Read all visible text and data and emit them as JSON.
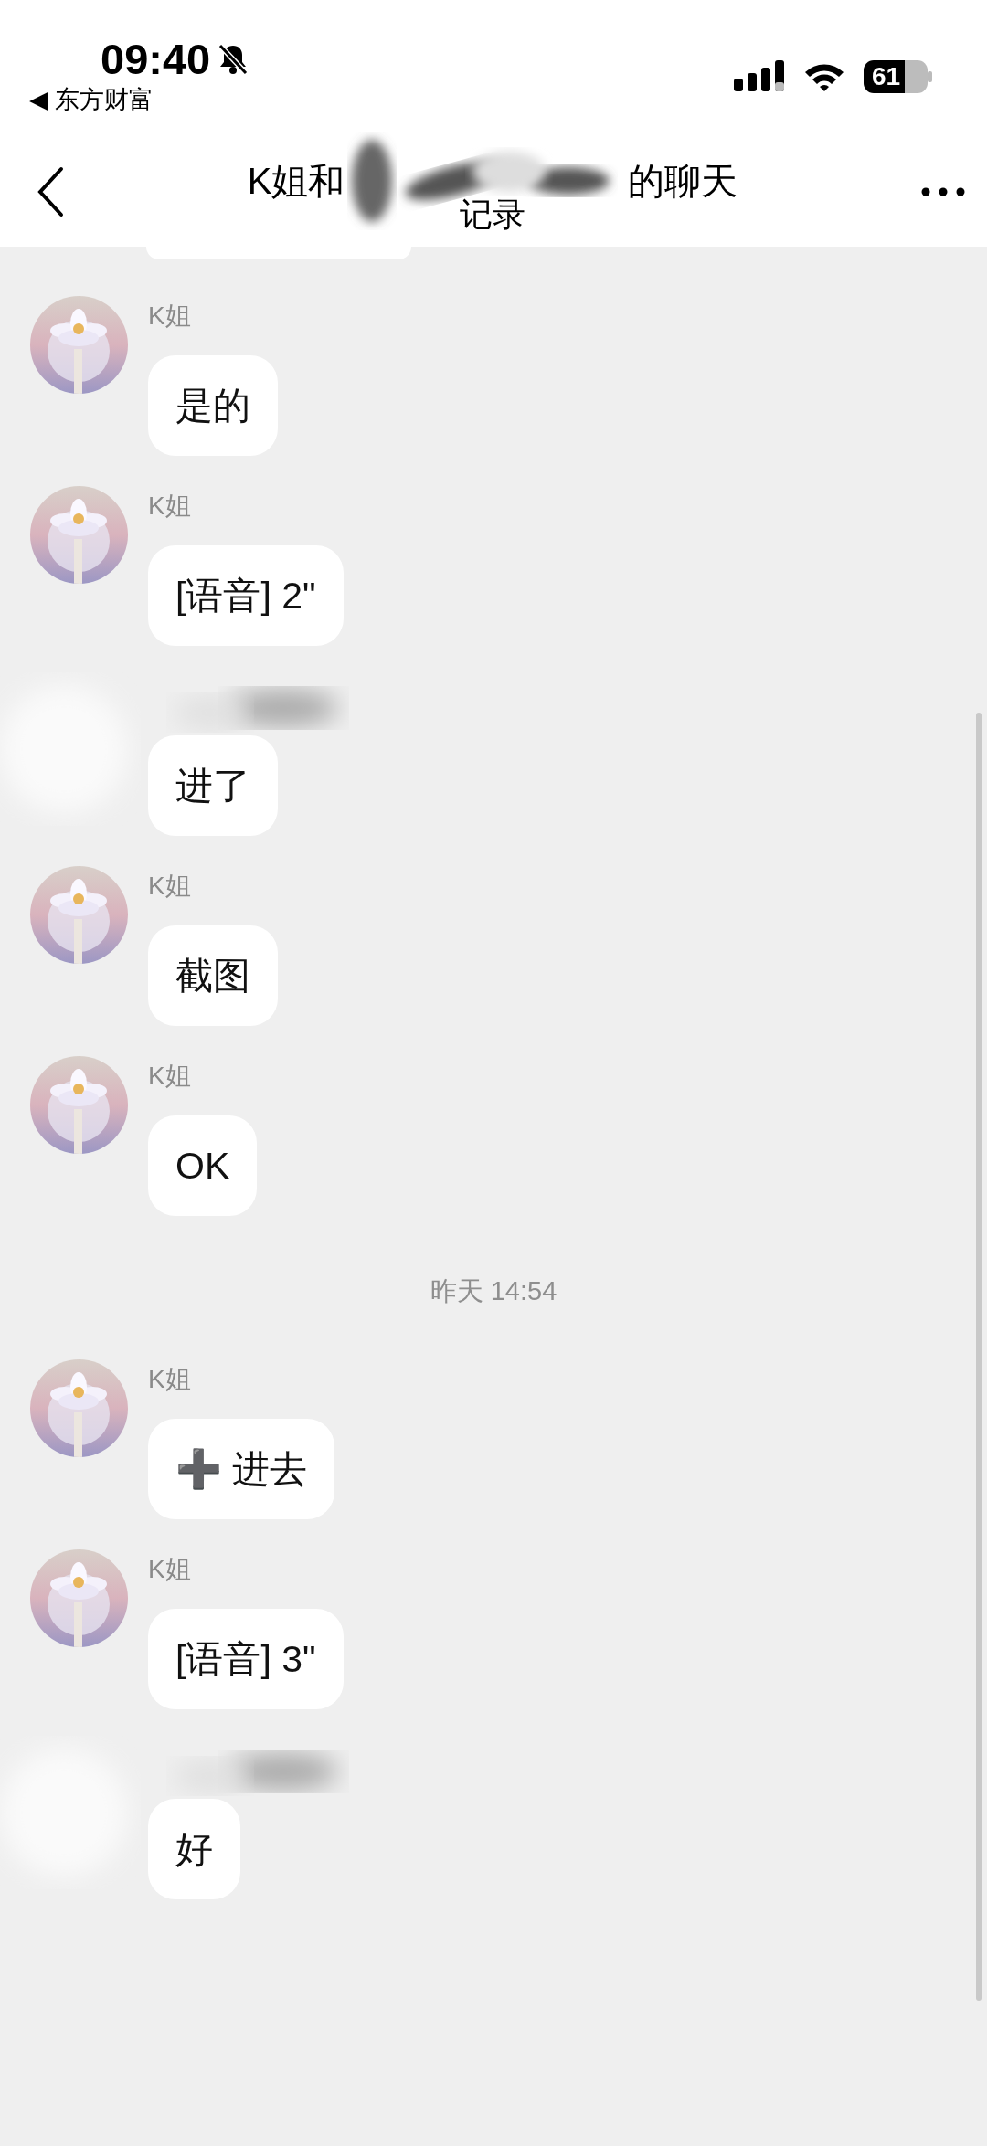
{
  "status_bar": {
    "time": "09:40",
    "back_app": "◀ 东方财富",
    "battery": "61"
  },
  "nav_bar": {
    "title_start": "K姐和",
    "title_end": "的聊天",
    "title_second_line": "记录"
  },
  "items": [
    {
      "kind": "message",
      "sender": "K姐",
      "sender_hidden": false,
      "text": "是的"
    },
    {
      "kind": "message",
      "sender": "K姐",
      "sender_hidden": false,
      "text": "[语音] 2\""
    },
    {
      "kind": "message",
      "sender_hidden": true,
      "text": "进了"
    },
    {
      "kind": "message",
      "sender": "K姐",
      "sender_hidden": false,
      "text": "截图"
    },
    {
      "kind": "message",
      "sender": "K姐",
      "sender_hidden": false,
      "text": "OK"
    },
    {
      "kind": "time",
      "text": "昨天 14:54"
    },
    {
      "kind": "message",
      "sender": "K姐",
      "sender_hidden": false,
      "text": "➕ 进去"
    },
    {
      "kind": "message",
      "sender": "K姐",
      "sender_hidden": false,
      "text": "[语音] 3\""
    },
    {
      "kind": "message",
      "sender_hidden": true,
      "text": "好"
    }
  ]
}
